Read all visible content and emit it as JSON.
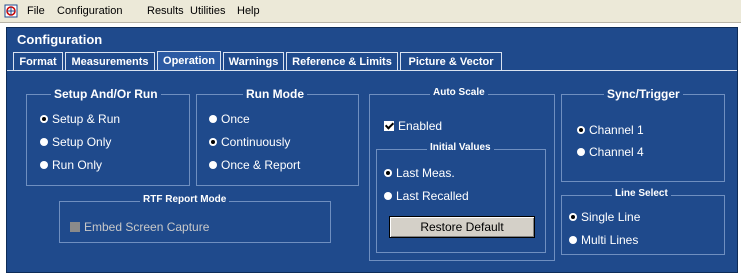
{
  "menu": [
    "File",
    "Configuration",
    "Results",
    "Utilities",
    "Help"
  ],
  "panel_title": "Configuration",
  "tabs": [
    "Format",
    "Measurements",
    "Operation",
    "Warnings",
    "Reference & Limits",
    "Picture & Vector"
  ],
  "active_tab": "Operation",
  "setup_run": {
    "title": "Setup And/Or Run",
    "options": [
      "Setup & Run",
      "Setup Only",
      "Run Only"
    ],
    "selected": "Setup & Run"
  },
  "run_mode": {
    "title": "Run Mode",
    "options": [
      "Once",
      "Continuously",
      "Once & Report"
    ],
    "selected": "Continuously"
  },
  "rtf_report": {
    "title": "RTF Report Mode",
    "checkbox_label": "Embed Screen Capture",
    "checked": false,
    "enabled": false
  },
  "auto_scale": {
    "title": "Auto Scale",
    "enabled_label": "Enabled",
    "enabled": true,
    "initial_values": {
      "title": "Initial Values",
      "options": [
        "Last Meas.",
        "Last Recalled"
      ],
      "selected": "Last Meas."
    },
    "restore_button": "Restore Default"
  },
  "sync_trigger": {
    "title": "Sync/Trigger",
    "options": [
      "Channel 1",
      "Channel 4"
    ],
    "selected": "Channel 1"
  },
  "line_select": {
    "title": "Line Select",
    "options": [
      "Single Line",
      "Multi Lines"
    ],
    "selected": "Single Line"
  }
}
